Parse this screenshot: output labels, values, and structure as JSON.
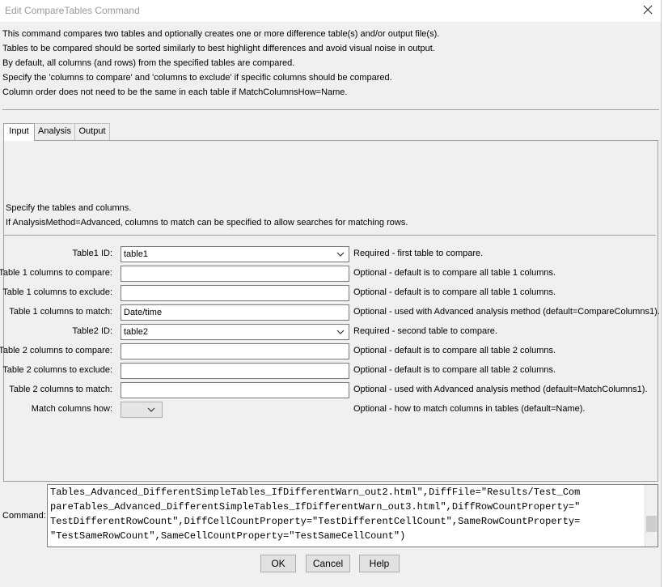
{
  "window": {
    "title": "Edit CompareTables Command"
  },
  "intro": [
    "This command compares two tables and optionally creates one or more difference table(s) and/or output file(s).",
    "Tables to be compared should be sorted similarly to best highlight differences and avoid visual noise in output.",
    "By default, all columns (and rows) from the specified tables are compared.",
    "Specify the 'columns to compare' and 'columns to exclude' if specific columns should be compared.",
    "Column order does not need to be the same in each table if MatchColumnsHow=Name."
  ],
  "tabs": [
    {
      "label": "Input",
      "active": true
    },
    {
      "label": "Analysis",
      "active": false
    },
    {
      "label": "Output",
      "active": false
    }
  ],
  "panel": {
    "line1": "Specify the tables and columns.",
    "line2": "If AnalysisMethod=Advanced, columns to match can be specified to allow searches for matching rows."
  },
  "form": {
    "table1_id": {
      "label": "Table1 ID:",
      "value": "table1",
      "hint": "Required - first table to compare."
    },
    "t1_compare": {
      "label": "Table 1 columns to compare:",
      "value": "",
      "hint": "Optional - default is to compare all table 1 columns."
    },
    "t1_exclude": {
      "label": "Table 1 columns to exclude:",
      "value": "",
      "hint": "Optional - default is to compare all table 1 columns."
    },
    "t1_match": {
      "label": "Table 1 columns to match:",
      "value": "Date/time",
      "hint": "Optional - used with Advanced analysis method (default=CompareColumns1)."
    },
    "table2_id": {
      "label": "Table2 ID:",
      "value": "table2",
      "hint": "Required - second table to compare."
    },
    "t2_compare": {
      "label": "Table 2 columns to compare:",
      "value": "",
      "hint": "Optional - default is to compare all table 2 columns."
    },
    "t2_exclude": {
      "label": "Table 2 columns to exclude:",
      "value": "",
      "hint": "Optional - default is to compare all table 2 columns."
    },
    "t2_match": {
      "label": "Table 2 columns to match:",
      "value": "",
      "hint": "Optional - used with Advanced analysis method (default=MatchColumns1)."
    },
    "match_how": {
      "label": "Match columns how:",
      "value": "",
      "hint": "Optional - how to match columns in tables (default=Name)."
    }
  },
  "command": {
    "label": "Command:",
    "text": "Tables_Advanced_DifferentSimpleTables_IfDifferentWarn_out2.html\",DiffFile=\"Results/Test_Com\npareTables_Advanced_DifferentSimpleTables_IfDifferentWarn_out3.html\",DiffRowCountProperty=\"\nTestDifferentRowCount\",DiffCellCountProperty=\"TestDifferentCellCount\",SameRowCountProperty=\n\"TestSameRowCount\",SameCellCountProperty=\"TestSameCellCount\")"
  },
  "buttons": {
    "ok": "OK",
    "cancel": "Cancel",
    "help": "Help"
  }
}
